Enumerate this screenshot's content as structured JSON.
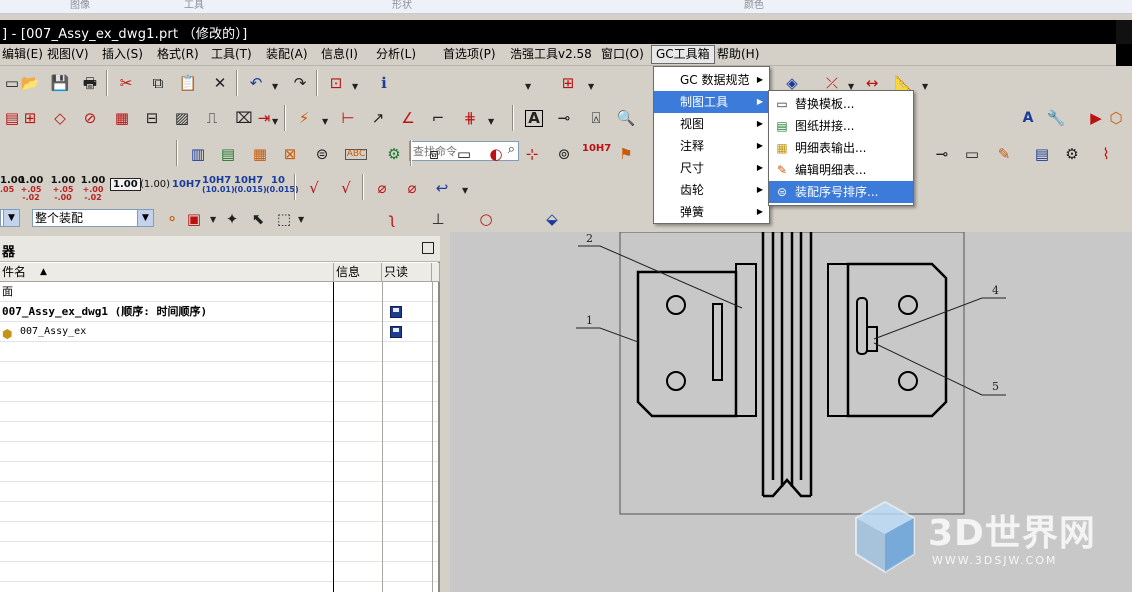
{
  "ribbon": {
    "labels": [
      "图像",
      "工具",
      "形状",
      "颜色"
    ]
  },
  "window": {
    "title": "] - [007_Assy_ex_dwg1.prt （修改的）]"
  },
  "menubar": {
    "items": [
      "编辑(E)",
      "视图(V)",
      "插入(S)",
      "格式(R)",
      "工具(T)",
      "装配(A)",
      "信息(I)",
      "分析(L)",
      "首选项(P)",
      "浩强工具v2.58",
      "窗口(O)",
      "GC工具箱",
      "帮助(H)"
    ]
  },
  "toolbar": {
    "search_placeholder": "查找命令",
    "tolerances": [
      {
        "main": "1.00",
        "sub": ".05"
      },
      {
        "main": "1.00",
        "sub": "+.05 -.02"
      },
      {
        "main": "1.00",
        "sub": "+.05 -.00"
      },
      {
        "main": "1.00",
        "sub": "+.00 -.02"
      },
      {
        "main": "1.00"
      },
      {
        "main": "(1.00)"
      },
      {
        "main": "10H7"
      },
      {
        "main": "10H7",
        "sub": "(10.01)"
      },
      {
        "main": "10H7",
        "sub": "(0.015)"
      },
      {
        "main": "10",
        "sub": "(0.015)"
      }
    ],
    "fit_label": "10H7",
    "assembly_filter": "整个装配"
  },
  "navigator": {
    "title": "器",
    "columns": [
      "件名",
      "信息",
      "只读"
    ],
    "rows": [
      {
        "text": "面",
        "bold": false
      },
      {
        "text": "007_Assy_ex_dwg1 (顺序: 时间顺序)",
        "bold": true
      },
      {
        "text": "007_Assy_ex",
        "bold": false
      }
    ]
  },
  "gc_menu": {
    "items": [
      {
        "label": "GC 数据规范",
        "submenu": true
      },
      {
        "label": "制图工具",
        "submenu": true,
        "highlighted": true
      },
      {
        "label": "视图",
        "submenu": true
      },
      {
        "label": "注释",
        "submenu": true
      },
      {
        "label": "尺寸",
        "submenu": true
      },
      {
        "label": "齿轮",
        "submenu": true
      },
      {
        "label": "弹簧",
        "submenu": true
      }
    ]
  },
  "drafting_submenu": {
    "items": [
      {
        "label": "替换模板...",
        "icon": "template-icon"
      },
      {
        "label": "图纸拼接...",
        "icon": "sheet-stitch-icon"
      },
      {
        "label": "明细表输出...",
        "icon": "parts-list-export-icon"
      },
      {
        "label": "编辑明细表...",
        "icon": "edit-parts-list-icon"
      },
      {
        "label": "装配序号排序...",
        "icon": "balloon-sort-icon",
        "highlighted": true
      }
    ]
  },
  "drawing": {
    "balloons": [
      "2",
      "1",
      "4",
      "5"
    ]
  },
  "watermark": {
    "title": "3D世界网",
    "url": "WWW.3DSJW.COM"
  }
}
